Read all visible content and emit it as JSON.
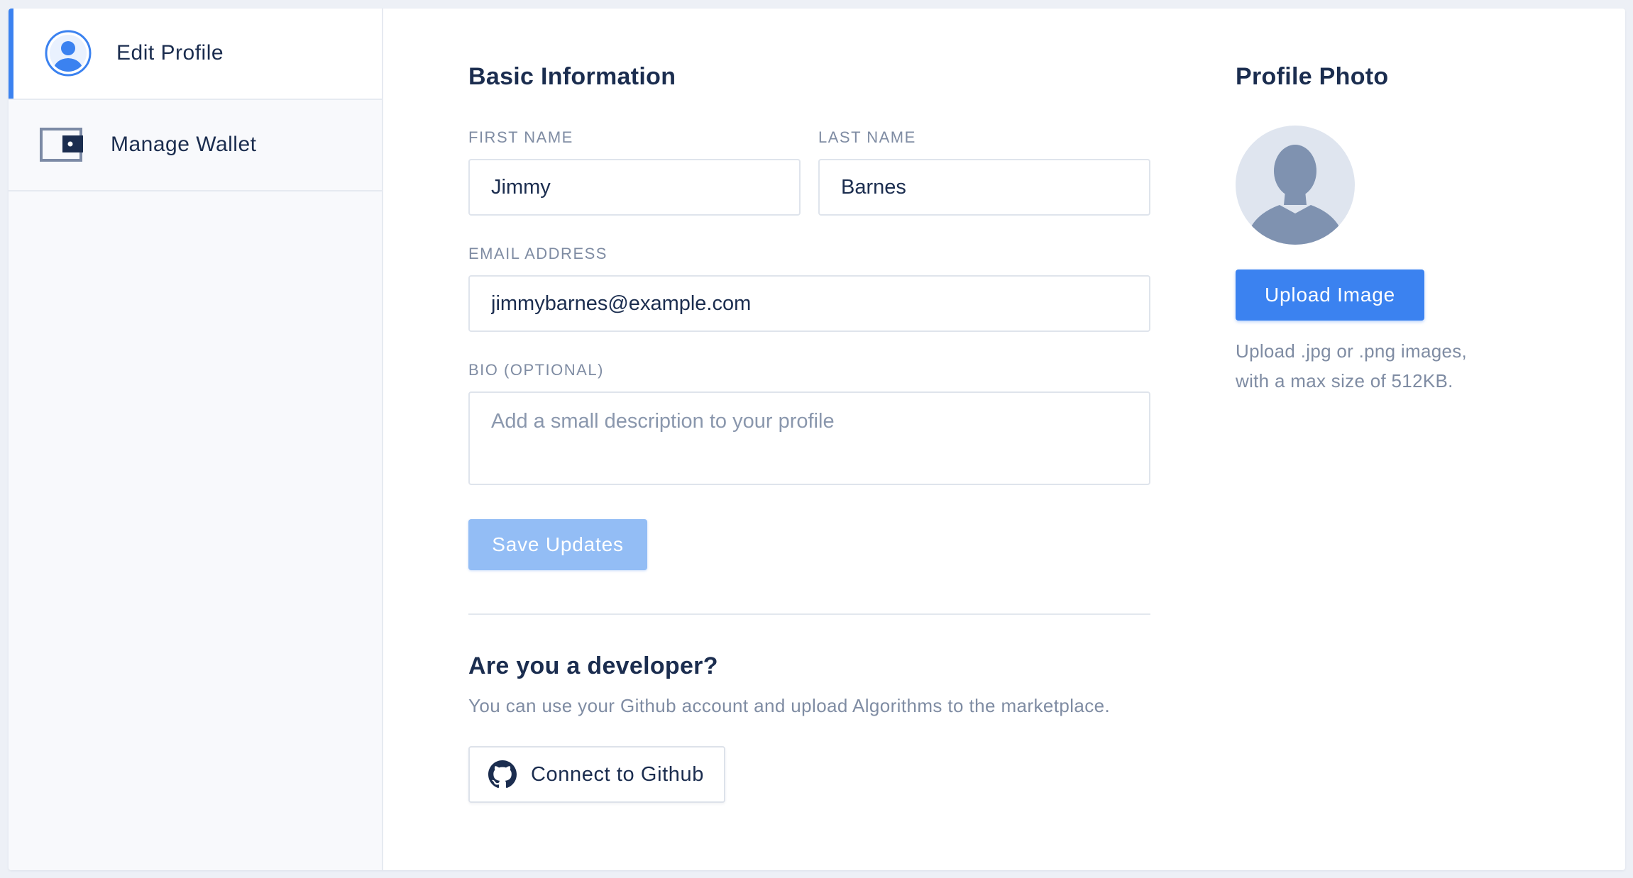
{
  "sidebar": {
    "items": [
      {
        "label": "Edit Profile",
        "icon": "user-circle-icon",
        "active": true
      },
      {
        "label": "Manage Wallet",
        "icon": "wallet-icon",
        "active": false
      }
    ]
  },
  "basic_info": {
    "title": "Basic Information",
    "first_name": {
      "label": "FIRST NAME",
      "value": "Jimmy"
    },
    "last_name": {
      "label": "LAST NAME",
      "value": "Barnes"
    },
    "email": {
      "label": "EMAIL ADDRESS",
      "value": "jimmybarnes@example.com"
    },
    "bio": {
      "label": "BIO (OPTIONAL)",
      "placeholder": "Add a small description to your profile",
      "value": ""
    },
    "save_label": "Save Updates"
  },
  "developer": {
    "title": "Are you a developer?",
    "description": "You can use your Github account and upload Algorithms to the marketplace.",
    "button_label": "Connect to Github",
    "button_icon": "github-icon"
  },
  "profile_photo": {
    "title": "Profile Photo",
    "upload_label": "Upload Image",
    "help_text": "Upload .jpg or .png images, with a max size of 512KB."
  },
  "colors": {
    "accent": "#3b82f0",
    "accent_disabled": "#93bdf5",
    "text": "#1b2d4f",
    "muted": "#7f8ca3"
  }
}
